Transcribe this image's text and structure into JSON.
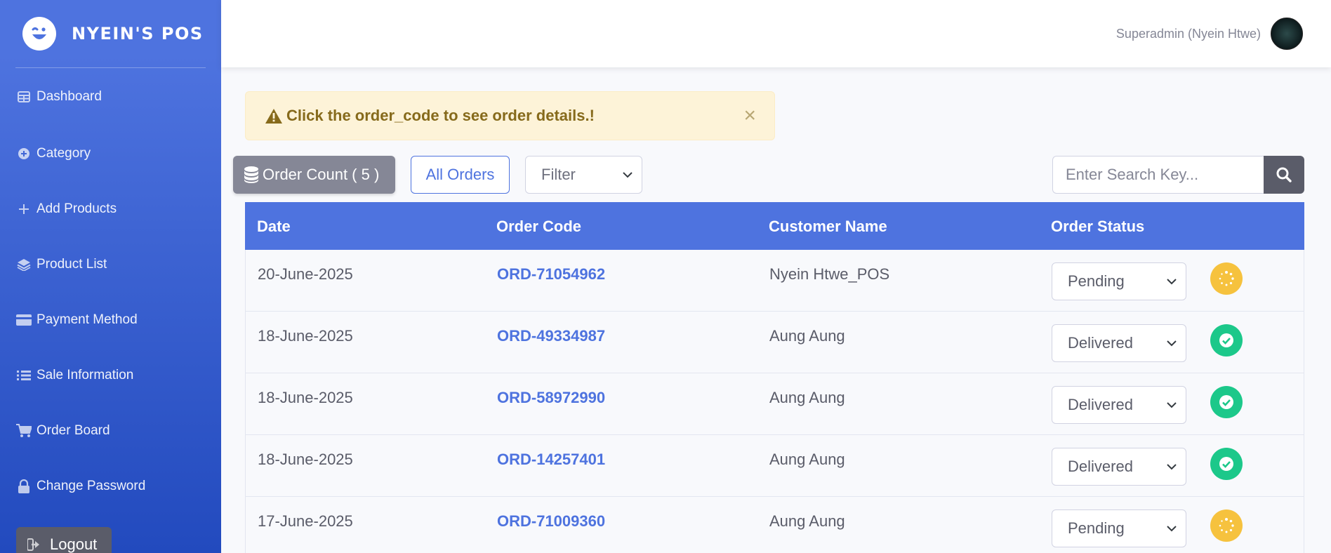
{
  "brand": {
    "name": "NYEIN'S POS",
    "logo_icon": "laughing-face-icon"
  },
  "sidebar": {
    "items": [
      {
        "label": "Dashboard",
        "icon": "table-icon"
      },
      {
        "label": "Category",
        "icon": "plus-circle-icon"
      },
      {
        "label": "Add Products",
        "icon": "plus-icon"
      },
      {
        "label": "Product List",
        "icon": "layers-icon"
      },
      {
        "label": "Payment Method",
        "icon": "credit-card-icon"
      },
      {
        "label": "Sale Information",
        "icon": "list-icon"
      },
      {
        "label": "Order Board",
        "icon": "cart-icon"
      },
      {
        "label": "Change Password",
        "icon": "lock-icon"
      }
    ],
    "logout_label": "Logout"
  },
  "topbar": {
    "user_name": "Superadmin (Nyein Htwe)"
  },
  "alert": {
    "text": "Click the order_code to see order details.!",
    "close": "×"
  },
  "controls": {
    "order_count_label": "Order Count ( 5 )",
    "all_orders_label": "All Orders",
    "filter_value": "Filter",
    "search_placeholder": "Enter Search Key..."
  },
  "table": {
    "headers": [
      "Date",
      "Order Code",
      "Customer Name",
      "Order Status"
    ],
    "rows": [
      {
        "date": "20-June-2025",
        "code": "ORD-71054962",
        "customer": "Nyein Htwe_POS",
        "status": "Pending"
      },
      {
        "date": "18-June-2025",
        "code": "ORD-49334987",
        "customer": "Aung Aung",
        "status": "Delivered"
      },
      {
        "date": "18-June-2025",
        "code": "ORD-58972990",
        "customer": "Aung Aung",
        "status": "Delivered"
      },
      {
        "date": "18-June-2025",
        "code": "ORD-14257401",
        "customer": "Aung Aung",
        "status": "Delivered"
      },
      {
        "date": "17-June-2025",
        "code": "ORD-71009360",
        "customer": "Aung Aung",
        "status": "Pending"
      }
    ]
  },
  "colors": {
    "primary": "#4e73df",
    "pending": "#f6c23e",
    "delivered": "#1cc88a",
    "alert_bg": "#fdf3d8"
  }
}
